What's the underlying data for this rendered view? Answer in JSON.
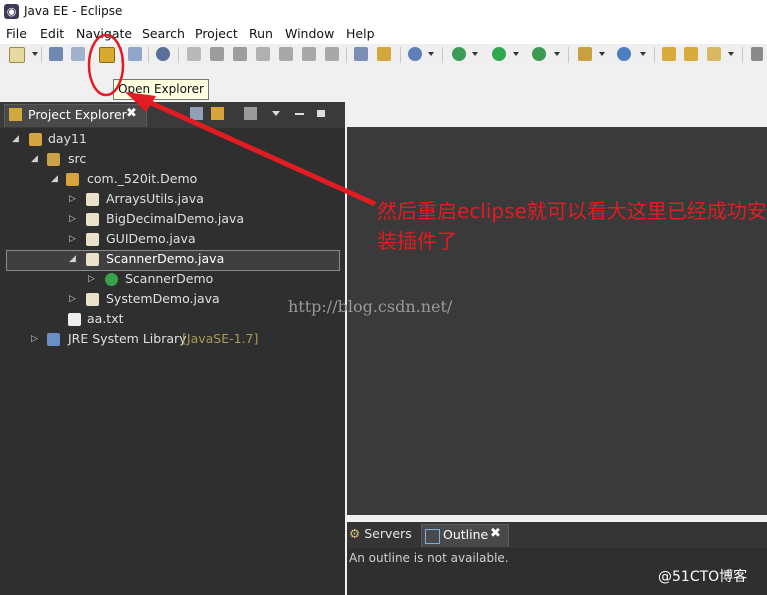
{
  "window": {
    "title": "Java EE - Eclipse"
  },
  "menu": [
    "File",
    "Edit",
    "Navigate",
    "Search",
    "Project",
    "Run",
    "Window",
    "Help"
  ],
  "tooltip": {
    "text": "Open Explorer"
  },
  "explorer": {
    "tab_label": "Project Explorer",
    "close_glyph": "✖",
    "tree": [
      {
        "label": "day11",
        "twisty": "◢",
        "icon": "java-project-icon"
      },
      {
        "label": "src",
        "twisty": "◢",
        "icon": "source-folder-icon"
      },
      {
        "label": "com._520it.Demo",
        "twisty": "◢",
        "icon": "package-icon"
      },
      {
        "label": "ArraysUtils.java",
        "twisty": "▷",
        "icon": "java-file-icon"
      },
      {
        "label": "BigDecimalDemo.java",
        "twisty": "▷",
        "icon": "java-file-icon"
      },
      {
        "label": "GUIDemo.java",
        "twisty": "▷",
        "icon": "java-file-icon"
      },
      {
        "label": "ScannerDemo.java",
        "twisty": "◢",
        "icon": "java-file-icon",
        "selected": true
      },
      {
        "label": "ScannerDemo",
        "twisty": "▷",
        "icon": "class-icon"
      },
      {
        "label": "SystemDemo.java",
        "twisty": "▷",
        "icon": "java-file-icon"
      },
      {
        "label": "aa.txt",
        "twisty": "",
        "icon": "text-file-icon"
      },
      {
        "label": "JRE System Library",
        "suffix": "[JavaSE-1.7]",
        "twisty": "▷",
        "icon": "library-icon"
      }
    ]
  },
  "bottom_panel": {
    "servers_label": "Servers",
    "outline_label": "Outline",
    "close_glyph": "✖",
    "message": "An outline is not available."
  },
  "annotation": {
    "text": "然后重启eclipse就可以看大这里已经成功安装插件了",
    "color": "#e31b23"
  },
  "watermark": "http://blog.csdn.net/",
  "brand": "@51CTO博客",
  "colors": {
    "dark_panel": "#2f2f2f",
    "accent_red": "#e31b23",
    "tooltip_bg": "#ffffe1"
  }
}
